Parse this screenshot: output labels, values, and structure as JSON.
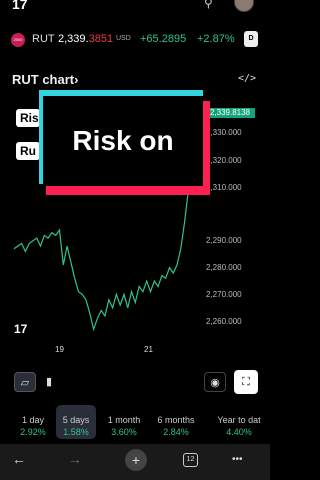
{
  "ticker": {
    "badge": "2000",
    "symbol": "RUT",
    "price_main": "2,339.",
    "price_decimals": "3851",
    "currency": "USD",
    "change": "+65.2895",
    "change_pct": "+2.87%",
    "flag": "D"
  },
  "chart_header": {
    "title": "RUT chart",
    "chevron": "›",
    "embed_symbol": "</>"
  },
  "overlay": {
    "text": "Risk on"
  },
  "chips": [
    "Ris",
    "Ru"
  ],
  "chart_data": {
    "type": "line",
    "title": "",
    "xlabel": "",
    "ylabel": "",
    "ylim": [
      2256,
      2344
    ],
    "y_ticks": [
      "2,330.000",
      "2,320.000",
      "2,310.000",
      "2,290.000",
      "2,280.000",
      "2,270.000",
      "2,260.000"
    ],
    "last_price_label": "2,339.8138",
    "x_ticks": [
      "19",
      "21"
    ],
    "series": [
      {
        "color": "#2cc48c",
        "values": [
          2290,
          2291,
          2292,
          2289,
          2292,
          2293,
          2294,
          2291,
          2295,
          2294,
          2296,
          2295,
          2297,
          2284,
          2291,
          2285,
          2279,
          2274,
          2273,
          2271,
          2266,
          2260,
          2264,
          2267,
          2265,
          2271,
          2268,
          2273,
          2269,
          2273,
          2268,
          2274,
          2270,
          2276,
          2274,
          2278,
          2274,
          2278,
          2276,
          2280,
          2279,
          2283,
          2281,
          2284,
          2290,
          2300,
          2312,
          2327,
          2340
        ]
      }
    ]
  },
  "tools": {
    "area_icon": "area-chart-icon",
    "candle_icon": "candlestick-icon",
    "camera_icon": "camera-icon",
    "fullscreen_icon": "fullscreen-icon"
  },
  "ranges": [
    {
      "label": "1 day",
      "value": "2.92%"
    },
    {
      "label": "5 days",
      "value": "1.58%"
    },
    {
      "label": "1 month",
      "value": "3.60%"
    },
    {
      "label": "6 months",
      "value": "2.84%"
    },
    {
      "label": "Year to dat",
      "value": "4.40%"
    }
  ],
  "browser": {
    "back": "←",
    "forward": "→",
    "new_tab": "+",
    "tab_count": "12",
    "more": "•••"
  },
  "colors": {
    "up": "#2cc48c",
    "accent_red": "#f23645",
    "overlay_cyan": "#33d6e0",
    "overlay_red": "#ff2052"
  }
}
